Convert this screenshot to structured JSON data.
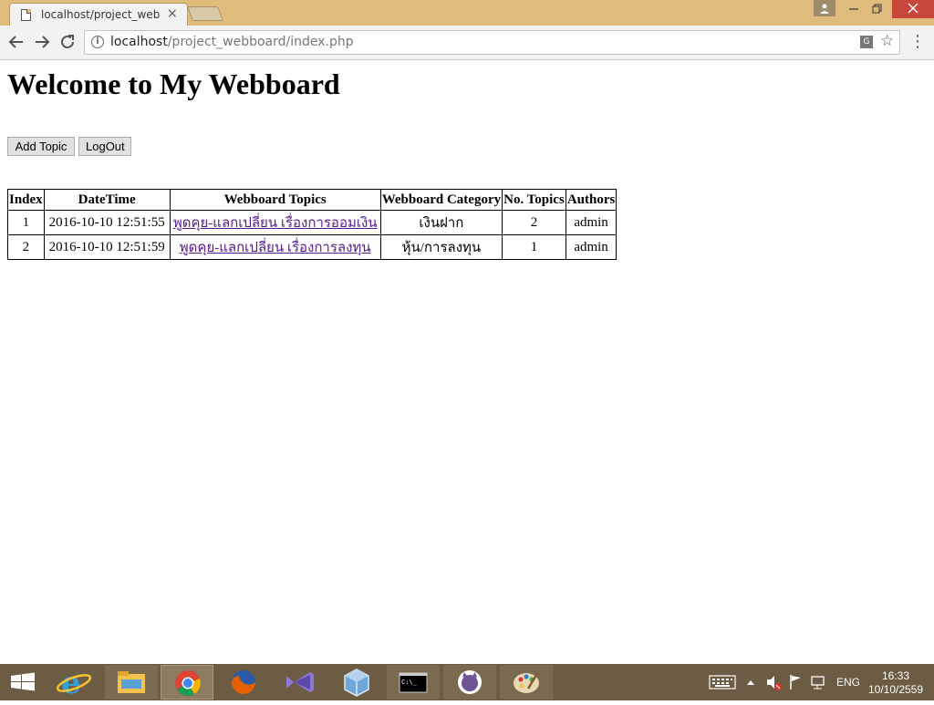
{
  "browser": {
    "tab_title": "localhost/project_webboard/index.php",
    "tab_close": "×",
    "url_host": "localhost",
    "url_path": "/project_webboard/index.php"
  },
  "page": {
    "heading": "Welcome to My Webboard",
    "buttons": {
      "add_topic": "Add Topic",
      "logout": "LogOut"
    },
    "table": {
      "headers": [
        "Index",
        "DateTime",
        "Webboard Topics",
        "Webboard Category",
        "No. Topics",
        "Authors"
      ],
      "rows": [
        {
          "index": "1",
          "datetime": "2016-10-10 12:51:55",
          "topic": "พูดคุย-แลกเปลี่ยน เรื่องการออมเงิน",
          "category": "เงินฝาก",
          "no_topics": "2",
          "author": "admin"
        },
        {
          "index": "2",
          "datetime": "2016-10-10 12:51:59",
          "topic": "พูดคุย-แลกเปลี่ยน เรื่องการลงทุน",
          "category": "หุ้น/การลงทุน",
          "no_topics": "1",
          "author": "admin"
        }
      ]
    }
  },
  "taskbar": {
    "apps": [
      "start-icon",
      "internet-explorer-icon",
      "file-explorer-icon",
      "chrome-icon",
      "firefox-icon",
      "visual-studio-icon",
      "virtualbox-icon",
      "command-prompt-icon",
      "github-icon",
      "paint-icon"
    ],
    "language": "ENG",
    "time": "16:33",
    "date": "10/10/2559"
  },
  "colors": {
    "tab_strip": "#e0bc7c",
    "taskbar": "#6b5c43",
    "link_visited": "#551a8b",
    "close_button": "#c9473a"
  }
}
